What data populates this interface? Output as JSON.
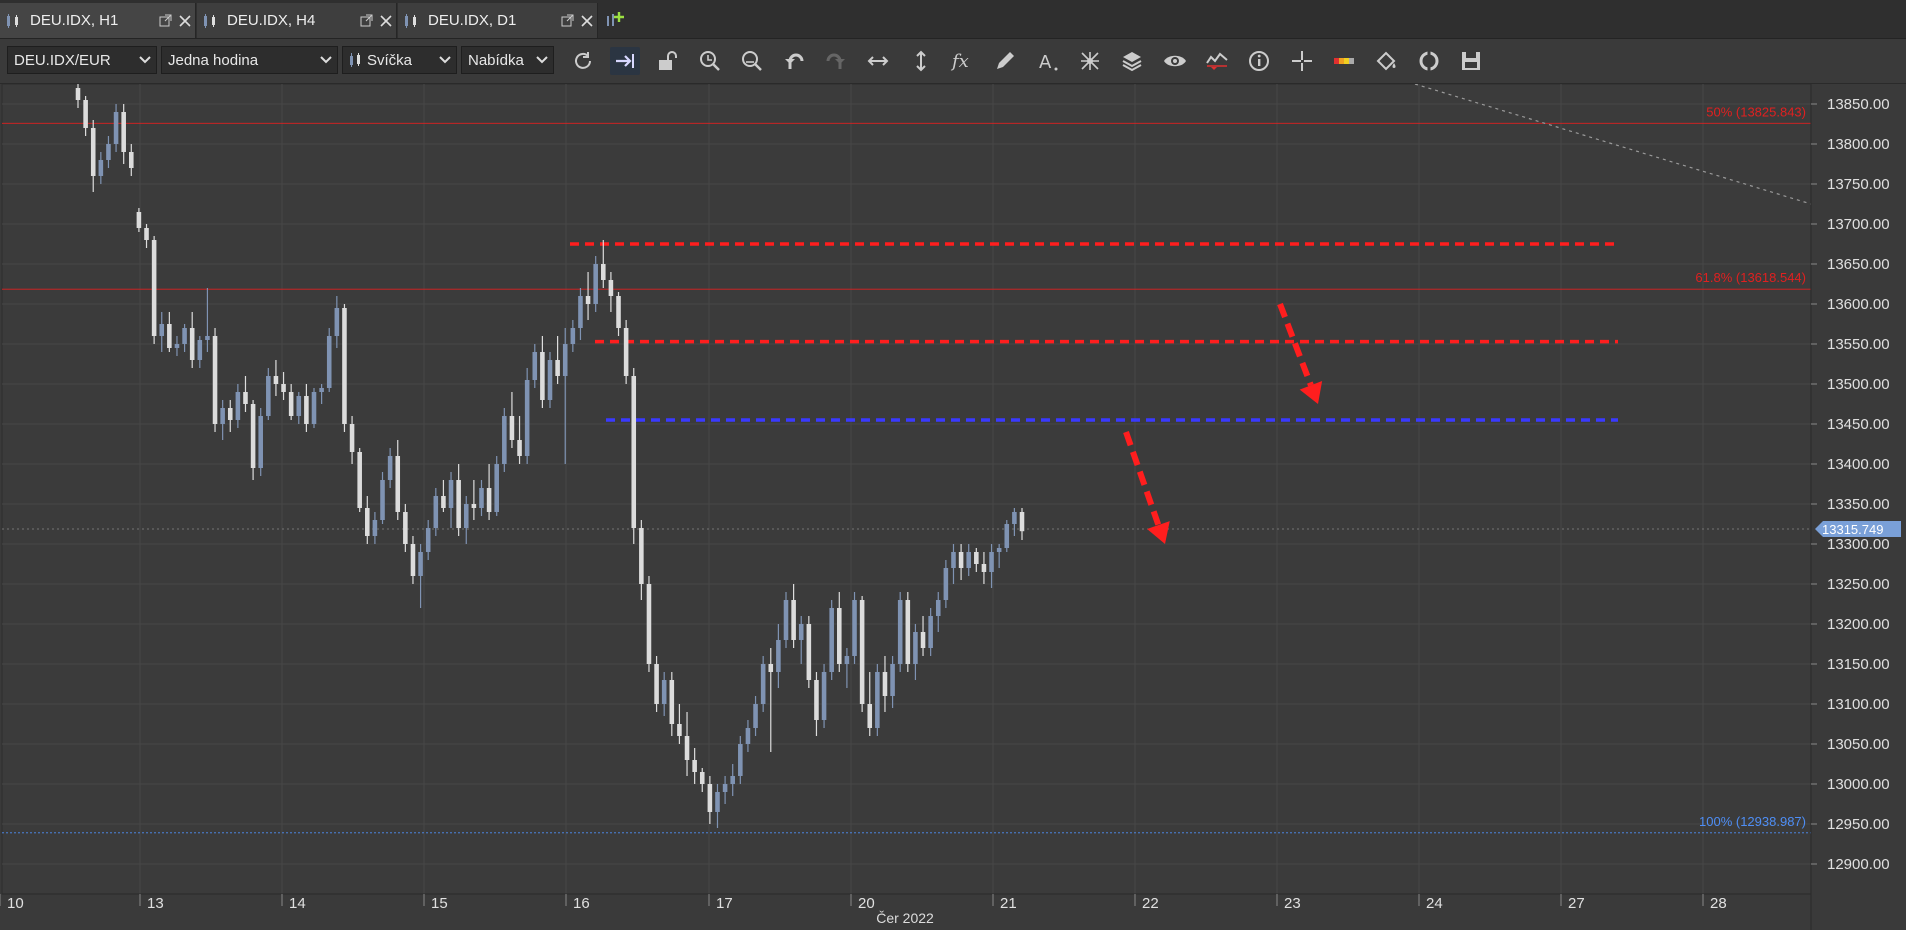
{
  "tabs": [
    {
      "label": "DEU.IDX, H1",
      "active": true
    },
    {
      "label": "DEU.IDX, H4",
      "active": false
    },
    {
      "label": "DEU.IDX, D1",
      "active": false
    }
  ],
  "toolbar": {
    "instrument": "DEU.IDX/EUR",
    "period": "Jedna hodina",
    "chart_type": "Svíčka",
    "price_side": "Nabídka",
    "icons": [
      "refresh-icon",
      "autoshift-icon",
      "unlock-icon",
      "zoom-in-icon",
      "zoom-out-icon",
      "undo-icon",
      "redo-icon",
      "horizontal-resize-icon",
      "vertical-resize-icon",
      "function-icon",
      "pencil-icon",
      "text-tool-icon",
      "pattern-icon",
      "layers-icon",
      "eye-icon",
      "signal-icon",
      "info-icon",
      "crosshair-icon",
      "theme-icon",
      "paint-bucket-icon",
      "sync-icon",
      "save-icon"
    ]
  },
  "colors": {
    "background": "#3b3b3b",
    "candle_bull": "#7f93b3",
    "candle_bear": "#dcdcdc",
    "red_line": "#ff1e1e",
    "blue_line": "#3a3aff",
    "fib_red": "#e02020",
    "fib_blue": "#4e8ef5",
    "grid": "#474747"
  },
  "chart_data": {
    "type": "candlestick",
    "instrument": "DEU.IDX",
    "timeframe": "H1",
    "x_tick_labels": [
      "10",
      "13",
      "14",
      "15",
      "16",
      "17",
      "20",
      "21",
      "22",
      "23",
      "24",
      "27",
      "28"
    ],
    "x_footer_label": "Čer 2022",
    "y_tick_labels": [
      "13850.00",
      "13800.00",
      "13750.00",
      "13700.00",
      "13650.00",
      "13600.00",
      "13550.00",
      "13500.00",
      "13450.00",
      "13400.00",
      "13350.00",
      "13300.00",
      "13250.00",
      "13200.00",
      "13150.00",
      "13100.00",
      "13050.00",
      "13000.00",
      "12950.00",
      "12900.00"
    ],
    "ylim": [
      12860,
      13880
    ],
    "current_price": "13315.749",
    "fib_levels": [
      {
        "label": "50% (13825.843)",
        "value": 13825.843,
        "color": "#e02020"
      },
      {
        "label": "61.8% (13618.544)",
        "value": 13618.544,
        "color": "#e02020"
      },
      {
        "label": "100% (12938.987)",
        "value": 12938.987,
        "color": "#4e8ef5"
      }
    ],
    "horizontal_lines": [
      {
        "value": 13675,
        "color": "red",
        "style": "dashed"
      },
      {
        "value": 13553,
        "color": "red",
        "style": "dashed"
      },
      {
        "value": 13455,
        "color": "blue",
        "style": "dashed"
      }
    ],
    "arrows": [
      {
        "from_day": "23",
        "from_price": 13600,
        "to_price": 13475,
        "color": "red"
      },
      {
        "from_day": "22",
        "from_price": 13440,
        "to_price": 13300,
        "color": "red"
      }
    ],
    "candles": [
      [
        13870,
        13880,
        13845,
        13855
      ],
      [
        13855,
        13860,
        13810,
        13820
      ],
      [
        13820,
        13830,
        13740,
        13760
      ],
      [
        13760,
        13790,
        13750,
        13780
      ],
      [
        13780,
        13810,
        13770,
        13800
      ],
      [
        13800,
        13850,
        13790,
        13840
      ],
      [
        13840,
        13850,
        13775,
        13790
      ],
      [
        13790,
        13800,
        13760,
        13770
      ],
      [
        13715,
        13720,
        13690,
        13695
      ],
      [
        13695,
        13700,
        13670,
        13680
      ],
      [
        13680,
        13685,
        13550,
        13560
      ],
      [
        13560,
        13590,
        13540,
        13575
      ],
      [
        13575,
        13590,
        13540,
        13545
      ],
      [
        13545,
        13560,
        13535,
        13550
      ],
      [
        13550,
        13575,
        13540,
        13570
      ],
      [
        13570,
        13590,
        13520,
        13530
      ],
      [
        13530,
        13560,
        13520,
        13555
      ],
      [
        13555,
        13620,
        13540,
        13560
      ],
      [
        13560,
        13570,
        13440,
        13450
      ],
      [
        13450,
        13480,
        13430,
        13470
      ],
      [
        13470,
        13480,
        13440,
        13455
      ],
      [
        13455,
        13500,
        13445,
        13490
      ],
      [
        13490,
        13510,
        13465,
        13475
      ],
      [
        13475,
        13480,
        13380,
        13395
      ],
      [
        13395,
        13470,
        13385,
        13460
      ],
      [
        13460,
        13520,
        13455,
        13510
      ],
      [
        13510,
        13530,
        13485,
        13500
      ],
      [
        13500,
        13515,
        13480,
        13490
      ],
      [
        13490,
        13500,
        13455,
        13460
      ],
      [
        13460,
        13490,
        13450,
        13485
      ],
      [
        13485,
        13500,
        13440,
        13450
      ],
      [
        13450,
        13495,
        13445,
        13490
      ],
      [
        13490,
        13500,
        13475,
        13495
      ],
      [
        13495,
        13570,
        13490,
        13560
      ],
      [
        13560,
        13610,
        13545,
        13595
      ],
      [
        13595,
        13600,
        13440,
        13450
      ],
      [
        13450,
        13460,
        13400,
        13415
      ],
      [
        13415,
        13420,
        13340,
        13345
      ],
      [
        13345,
        13360,
        13300,
        13310
      ],
      [
        13310,
        13340,
        13300,
        13330
      ],
      [
        13330,
        13390,
        13325,
        13380
      ],
      [
        13380,
        13420,
        13370,
        13410
      ],
      [
        13410,
        13430,
        13330,
        13340
      ],
      [
        13340,
        13350,
        13290,
        13300
      ],
      [
        13300,
        13310,
        13250,
        13260
      ],
      [
        13260,
        13300,
        13220,
        13290
      ],
      [
        13290,
        13330,
        13280,
        13320
      ],
      [
        13320,
        13370,
        13310,
        13360
      ],
      [
        13360,
        13380,
        13340,
        13345
      ],
      [
        13345,
        13390,
        13320,
        13380
      ],
      [
        13380,
        13400,
        13310,
        13320
      ],
      [
        13320,
        13360,
        13300,
        13350
      ],
      [
        13350,
        13380,
        13330,
        13345
      ],
      [
        13345,
        13380,
        13335,
        13370
      ],
      [
        13370,
        13400,
        13330,
        13340
      ],
      [
        13340,
        13410,
        13335,
        13400
      ],
      [
        13400,
        13470,
        13390,
        13460
      ],
      [
        13460,
        13490,
        13420,
        13430
      ],
      [
        13430,
        13460,
        13400,
        13410
      ],
      [
        13410,
        13520,
        13400,
        13505
      ],
      [
        13505,
        13550,
        13495,
        13540
      ],
      [
        13540,
        13560,
        13470,
        13480
      ],
      [
        13480,
        13540,
        13470,
        13530
      ],
      [
        13530,
        13560,
        13500,
        13510
      ],
      [
        13510,
        13570,
        13400,
        13550
      ],
      [
        13550,
        13580,
        13540,
        13570
      ],
      [
        13570,
        13620,
        13555,
        13610
      ],
      [
        13610,
        13640,
        13580,
        13600
      ],
      [
        13600,
        13660,
        13590,
        13650
      ],
      [
        13650,
        13680,
        13620,
        13630
      ],
      [
        13630,
        13640,
        13590,
        13610
      ],
      [
        13610,
        13615,
        13560,
        13570
      ],
      [
        13570,
        13580,
        13500,
        13510
      ],
      [
        13510,
        13520,
        13300,
        13320
      ],
      [
        13320,
        13330,
        13230,
        13250
      ],
      [
        13250,
        13260,
        13140,
        13150
      ],
      [
        13150,
        13160,
        13090,
        13100
      ],
      [
        13100,
        13140,
        13085,
        13130
      ],
      [
        13130,
        13140,
        13060,
        13075
      ],
      [
        13075,
        13100,
        13050,
        13060
      ],
      [
        13060,
        13090,
        13010,
        13030
      ],
      [
        13030,
        13045,
        13000,
        13015
      ],
      [
        13015,
        13020,
        12990,
        13000
      ],
      [
        13000,
        13010,
        12950,
        12965
      ],
      [
        12965,
        13000,
        12945,
        12990
      ],
      [
        12990,
        13010,
        12975,
        13000
      ],
      [
        13000,
        13025,
        12985,
        13010
      ],
      [
        13010,
        13060,
        13000,
        13050
      ],
      [
        13050,
        13080,
        13040,
        13070
      ],
      [
        13070,
        13110,
        13060,
        13100
      ],
      [
        13100,
        13160,
        13090,
        13150
      ],
      [
        13150,
        13170,
        13040,
        13140
      ],
      [
        13140,
        13200,
        13120,
        13180
      ],
      [
        13180,
        13240,
        13170,
        13230
      ],
      [
        13230,
        13250,
        13170,
        13180
      ],
      [
        13180,
        13210,
        13150,
        13200
      ],
      [
        13200,
        13210,
        13120,
        13130
      ],
      [
        13130,
        13140,
        13060,
        13080
      ],
      [
        13080,
        13150,
        13070,
        13140
      ],
      [
        13140,
        13230,
        13130,
        13220
      ],
      [
        13220,
        13240,
        13140,
        13150
      ],
      [
        13150,
        13170,
        13120,
        13160
      ],
      [
        13160,
        13240,
        13150,
        13230
      ],
      [
        13230,
        13235,
        13090,
        13100
      ],
      [
        13100,
        13140,
        13060,
        13070
      ],
      [
        13070,
        13150,
        13060,
        13140
      ],
      [
        13140,
        13160,
        13090,
        13110
      ],
      [
        13110,
        13160,
        13095,
        13150
      ],
      [
        13150,
        13240,
        13140,
        13230
      ],
      [
        13230,
        13240,
        13140,
        13150
      ],
      [
        13150,
        13200,
        13130,
        13190
      ],
      [
        13190,
        13210,
        13160,
        13170
      ],
      [
        13170,
        13220,
        13160,
        13210
      ],
      [
        13210,
        13240,
        13190,
        13230
      ],
      [
        13230,
        13280,
        13220,
        13270
      ],
      [
        13270,
        13300,
        13250,
        13290
      ],
      [
        13290,
        13300,
        13255,
        13270
      ],
      [
        13270,
        13300,
        13260,
        13290
      ],
      [
        13290,
        13295,
        13265,
        13275
      ],
      [
        13275,
        13290,
        13250,
        13265
      ],
      [
        13265,
        13300,
        13245,
        13290
      ],
      [
        13290,
        13300,
        13270,
        13295
      ],
      [
        13295,
        13330,
        13290,
        13325
      ],
      [
        13325,
        13345,
        13310,
        13340
      ],
      [
        13340,
        13345,
        13305,
        13316
      ]
    ]
  }
}
